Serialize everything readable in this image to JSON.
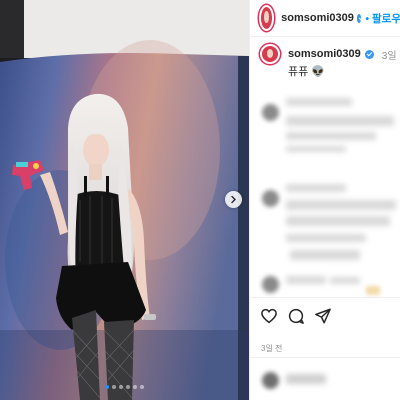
{
  "post": {
    "username": "somsomi0309",
    "follow_label": "• 팔로우",
    "caption_username": "somsomi0309",
    "time_ago": "3일",
    "caption_text": "퓨퓨 👽",
    "date": "3일 전"
  },
  "carousel": {
    "total_slides": 6,
    "active_slide": 1,
    "next_icon": "chevron-right-icon"
  },
  "actions": {
    "like_icon": "heart-icon",
    "comment_icon": "comment-icon",
    "share_icon": "send-icon"
  },
  "colors": {
    "accent": "#0095f6",
    "verified": "#3897f0",
    "text": "#262626",
    "secondary": "#8e8e8e",
    "divider": "#efefef"
  }
}
